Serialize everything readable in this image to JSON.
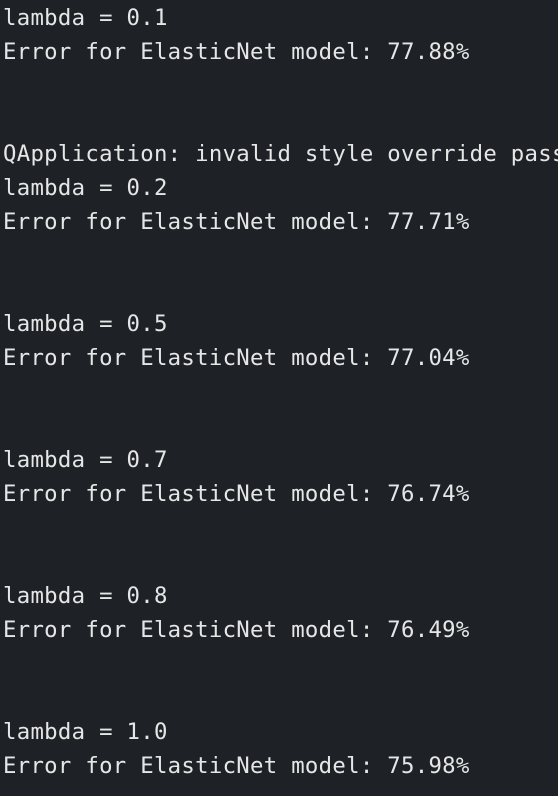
{
  "terminal": {
    "lines": [
      "lambda = 0.1",
      "Error for ElasticNet model: 77.88%",
      "",
      "",
      "QApplication: invalid style override passed, ignoring it.",
      "lambda = 0.2",
      "Error for ElasticNet model: 77.71%",
      "",
      "",
      "lambda = 0.5",
      "Error for ElasticNet model: 77.04%",
      "",
      "",
      "lambda = 0.7",
      "Error for ElasticNet model: 76.74%",
      "",
      "",
      "lambda = 0.8",
      "Error for ElasticNet model: 76.49%",
      "",
      "",
      "lambda = 1.0",
      "Error for ElasticNet model: 75.98%"
    ]
  }
}
